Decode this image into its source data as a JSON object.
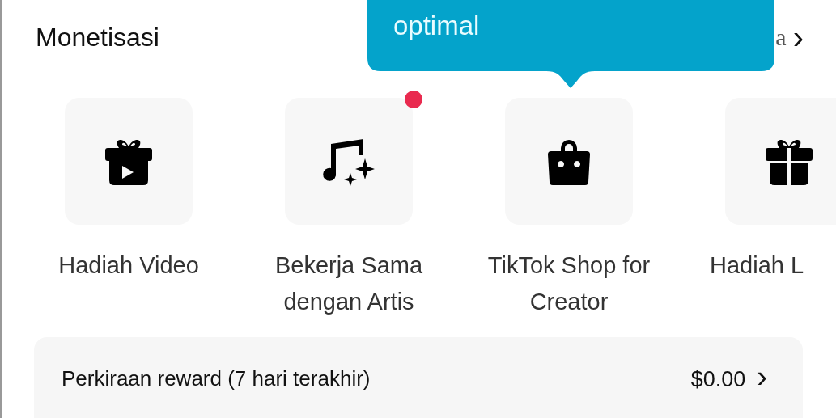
{
  "header": {
    "title": "Monetisasi",
    "link_text": "a",
    "chevron": "›"
  },
  "tooltip": {
    "text": "optimal"
  },
  "features": [
    {
      "kind": "gift-video",
      "label": "Hadiah Video",
      "badge": false
    },
    {
      "kind": "music",
      "label": "Bekerja Sama dengan Artis",
      "badge": true
    },
    {
      "kind": "bag",
      "label": "TikTok Shop for Creator",
      "badge": false
    },
    {
      "kind": "gift",
      "label": "Hadiah L"
    }
  ],
  "reward": {
    "label": "Perkiraan reward (7 hari terakhir)",
    "value": "$0.00",
    "chevron": "›"
  }
}
